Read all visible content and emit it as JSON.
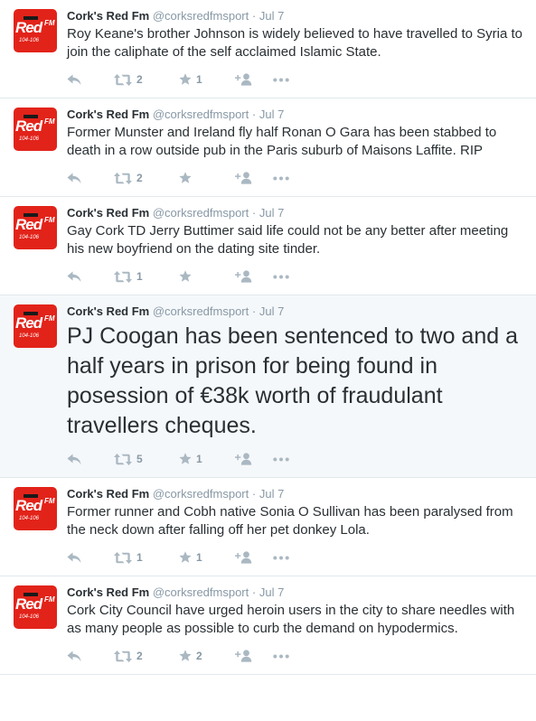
{
  "colors": {
    "brand": "#e2231a",
    "text": "#292f33",
    "muted": "#8899a6",
    "icon": "#aab8c2",
    "border": "#e1e8ed",
    "highlight_background": "#f5f8fa"
  },
  "avatar": {
    "logo_word": "Red",
    "logo_fm": "FM",
    "logo_freq": "104-106"
  },
  "tweets": [
    {
      "author": "Cork's Red Fm",
      "handle": "@corksredfmsport",
      "separator": "·",
      "time": "Jul 7",
      "text": "Roy Keane's brother Johnson is widely believed to have travelled to Syria to join the caliphate of the self acclaimed Islamic State.",
      "retweets": "2",
      "favorites": "1",
      "large": false,
      "highlighted": false
    },
    {
      "author": "Cork's Red Fm",
      "handle": "@corksredfmsport",
      "separator": "·",
      "time": "Jul 7",
      "text": "Former Munster and Ireland fly half Ronan O Gara has been stabbed to death in a row outside pub in the Paris suburb of Maisons Laffite. RIP",
      "retweets": "2",
      "favorites": "",
      "large": false,
      "highlighted": false
    },
    {
      "author": "Cork's Red Fm",
      "handle": "@corksredfmsport",
      "separator": "·",
      "time": "Jul 7",
      "text": "Gay Cork TD Jerry Buttimer said life could not be any better after meeting his new boyfriend on the dating site tinder.",
      "retweets": "1",
      "favorites": "",
      "large": false,
      "highlighted": false
    },
    {
      "author": "Cork's Red Fm",
      "handle": "@corksredfmsport",
      "separator": "·",
      "time": "Jul 7",
      "text": "PJ Coogan has been sentenced to two and a half years in prison for being found in posession of €38k worth of fraudulant travellers cheques.",
      "retweets": "5",
      "favorites": "1",
      "large": true,
      "highlighted": true
    },
    {
      "author": "Cork's Red Fm",
      "handle": "@corksredfmsport",
      "separator": "·",
      "time": "Jul 7",
      "text": "Former runner and Cobh native Sonia O Sullivan has been paralysed from the neck down after falling off her pet donkey Lola.",
      "retweets": "1",
      "favorites": "1",
      "large": false,
      "highlighted": false
    },
    {
      "author": "Cork's Red Fm",
      "handle": "@corksredfmsport",
      "separator": "·",
      "time": "Jul 7",
      "text": "Cork City Council have urged heroin users in the city to share needles with as many people as possible to curb the demand on hypodermics.",
      "retweets": "2",
      "favorites": "2",
      "large": false,
      "highlighted": false
    }
  ]
}
